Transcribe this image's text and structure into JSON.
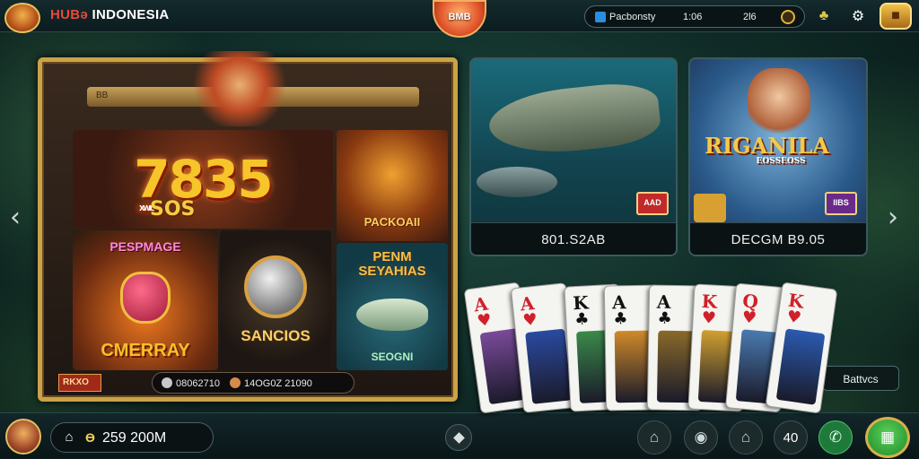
{
  "header": {
    "brand_part1": "HUBə",
    "brand_part2": " INDONESIA",
    "center_badge": "BMB",
    "stats": {
      "label": "Pacbonsty",
      "value1": "1:06",
      "value2": "2l6"
    }
  },
  "featured": {
    "header_text": "BB",
    "tile_777": {
      "main": "7835",
      "sub": "SOS",
      "tag": "XWIO"
    },
    "tile_pack": "PACKOAII",
    "tile_perm": {
      "top": "PESPMAGE",
      "bottom": "CMERRAY"
    },
    "tile_coin": "SANCIOS",
    "tile_fish": {
      "top": "PENM\nSEYAHIAS",
      "bottom": "SEOGNI"
    },
    "footer": {
      "tag": "RKXO",
      "value1": "08062710",
      "value2": "14OG0Z 21090"
    }
  },
  "cards": [
    {
      "label": "801.S2AB",
      "badge": "AAD"
    },
    {
      "label": "DECGM B9.05",
      "title": "RIGANILA",
      "subtitle": "EOSSEOSS",
      "badge": "IIBS"
    }
  ],
  "playing_cards": [
    {
      "rank": "A",
      "suit": "♥",
      "color": "red"
    },
    {
      "rank": "A",
      "suit": "♥",
      "color": "red"
    },
    {
      "rank": "K",
      "suit": "♣",
      "color": "black"
    },
    {
      "rank": "A",
      "suit": "♣",
      "color": "black"
    },
    {
      "rank": "A",
      "suit": "♣",
      "color": "black"
    },
    {
      "rank": "K",
      "suit": "♥",
      "color": "red"
    },
    {
      "rank": "Q",
      "suit": "♥",
      "color": "red"
    },
    {
      "rank": "K",
      "suit": "♥",
      "color": "red"
    }
  ],
  "bet_button": "Battvcs",
  "footer": {
    "balance": "259 200M",
    "count": "40"
  },
  "icons": {
    "prev": "chevron-left",
    "next": "chevron-right",
    "home": "home",
    "chip": "chip",
    "store": "store",
    "phone": "phone",
    "menu": "menu"
  }
}
